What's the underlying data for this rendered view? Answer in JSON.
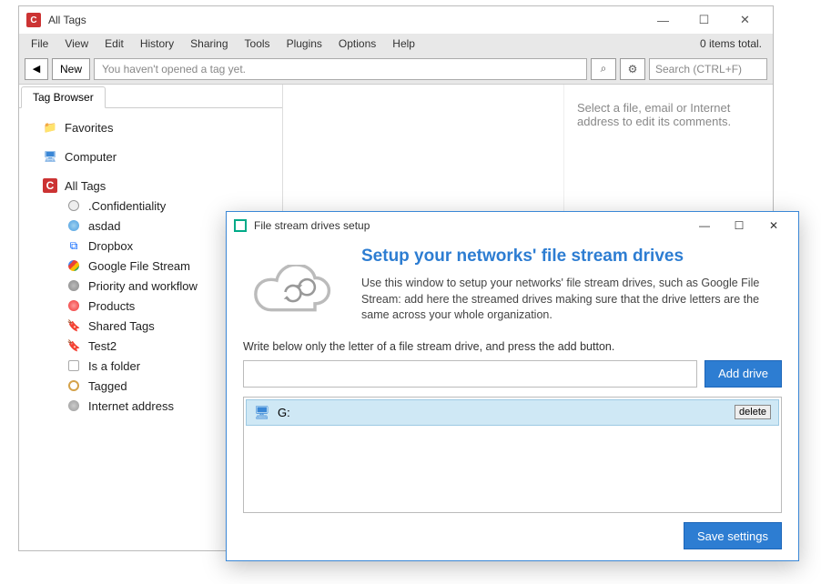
{
  "main": {
    "app_icon_letter": "C",
    "title": "All Tags",
    "menus": [
      "File",
      "View",
      "Edit",
      "History",
      "Sharing",
      "Tools",
      "Plugins",
      "Options",
      "Help"
    ],
    "status_text": "0 items total.",
    "toolbar": {
      "back_glyph": "◀",
      "new_label": "New",
      "tag_placeholder": "You haven't opened a tag yet.",
      "search_glyph": "⌕",
      "gear_glyph": "⚙",
      "search_placeholder": "Search (CTRL+F)"
    },
    "sidebar": {
      "tab_label": "Tag Browser",
      "favorites_label": "Favorites",
      "computer_label": "Computer",
      "alltags_label": "All Tags",
      "children": [
        {
          "label": ".Confidentiality",
          "icon": "dot"
        },
        {
          "label": "asdad",
          "icon": "blue-dot"
        },
        {
          "label": "Dropbox",
          "icon": "dropbox"
        },
        {
          "label": "Google File Stream",
          "icon": "google"
        },
        {
          "label": "Priority and workflow",
          "icon": "gray-dot"
        },
        {
          "label": "Products",
          "icon": "red-dot"
        },
        {
          "label": "Shared Tags",
          "icon": "tag"
        },
        {
          "label": "Test2",
          "icon": "tag"
        },
        {
          "label": "Is a folder",
          "icon": "box"
        },
        {
          "label": "Tagged",
          "icon": "target"
        },
        {
          "label": "Internet address",
          "icon": "globe"
        }
      ]
    },
    "right_hint": "Select a file, email or Internet address to edit its comments."
  },
  "dialog": {
    "title": "File stream drives setup",
    "heading": "Setup your networks' file stream drives",
    "description": "Use this window to setup your networks' file stream drives, such as Google File Stream: add here the streamed drives making sure that the drive letters  are the same across your whole organization.",
    "instruction": "Write below only the letter of a file stream drive, and press the add button.",
    "drive_input_value": "",
    "add_label": "Add drive",
    "drives": [
      {
        "label": "G:",
        "delete_label": "delete"
      }
    ],
    "save_label": "Save settings"
  }
}
